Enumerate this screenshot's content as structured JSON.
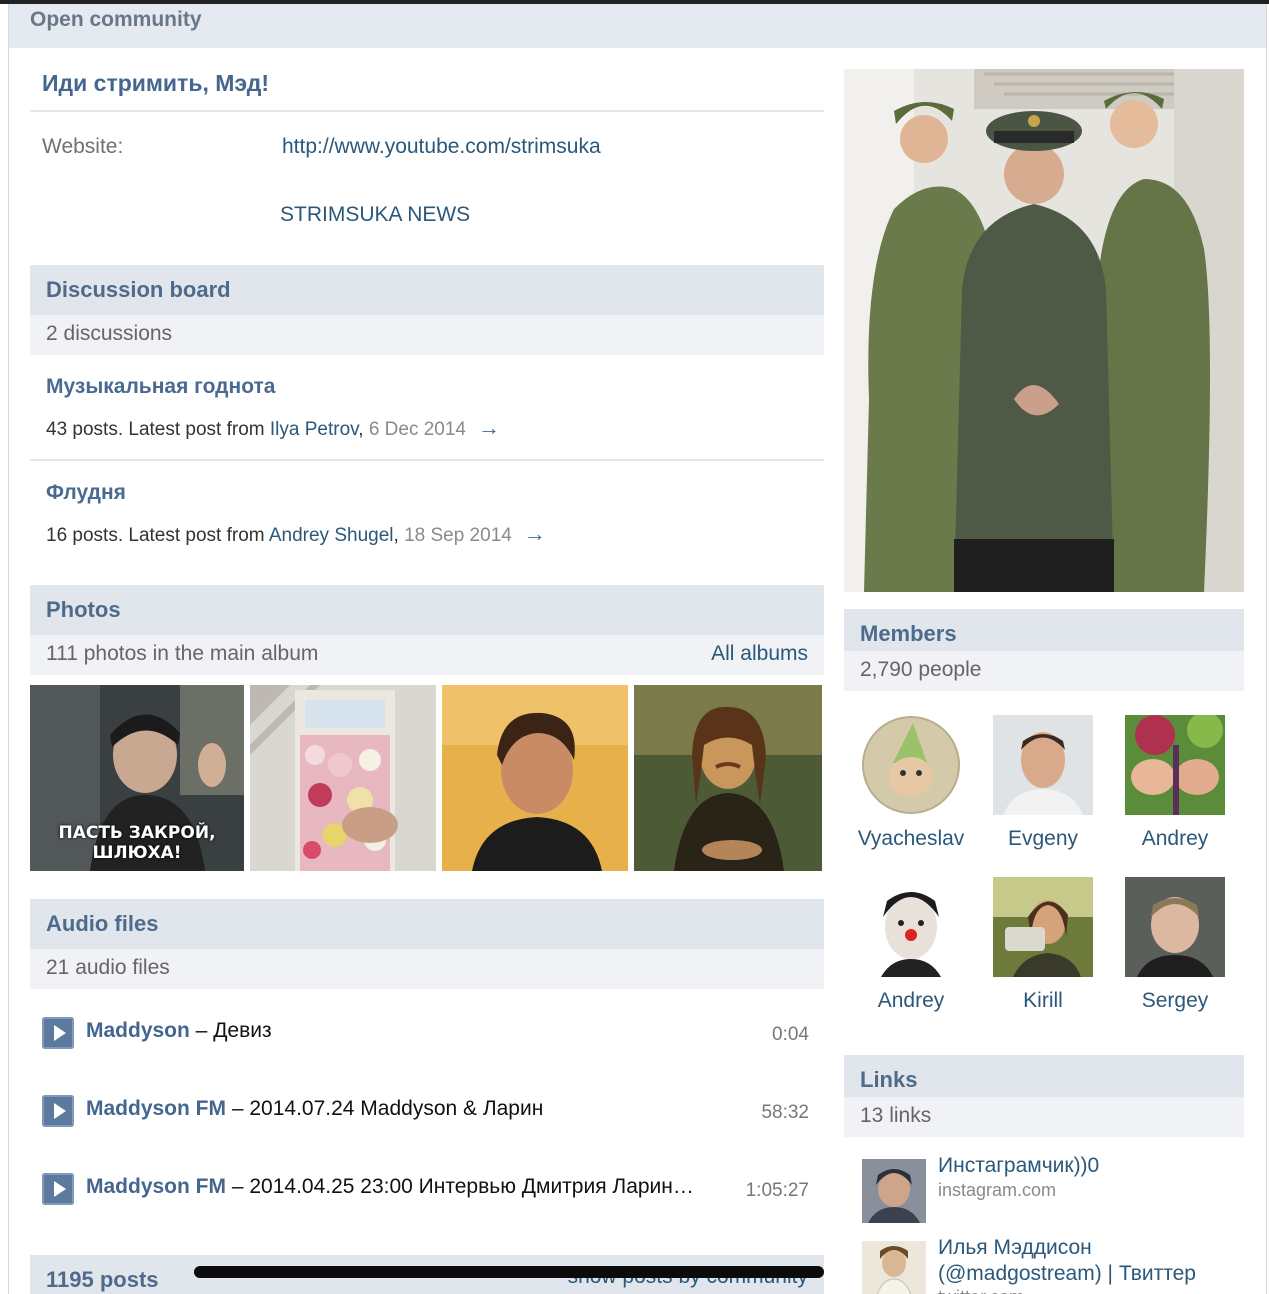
{
  "header": {
    "open_label": "Open community"
  },
  "community": {
    "title": "Иди стримить, Мэд!",
    "website_label": "Website:",
    "website_value": "http://www.youtube.com/strimsuka",
    "news_label": "STRIMSUKA NEWS"
  },
  "discussions": {
    "heading": "Discussion board",
    "count": "2 discussions",
    "items": [
      {
        "title": "Музыкальная годнота",
        "meta_prefix": "43 posts. Latest post from ",
        "author": "Ilya Petrov",
        "date": "6 Dec 2014",
        "arrow": "→"
      },
      {
        "title": "Флудня",
        "meta_prefix": "16 posts. Latest post from ",
        "author": "Andrey Shugel",
        "date": "18 Sep 2014",
        "arrow": "→"
      }
    ]
  },
  "photos": {
    "heading": "Photos",
    "count": "111 photos in the main album",
    "all_albums": "All albums",
    "caption_first": "ПАСТЬ ЗАКРОЙ, ШЛЮХА!"
  },
  "audio": {
    "heading": "Audio files",
    "count": "21 audio files",
    "tracks": [
      {
        "artist": "Maddyson",
        "title": " – Девиз",
        "duration": "0:04"
      },
      {
        "artist": "Maddyson FM",
        "title": " – 2014.07.24 Maddyson & Ларин",
        "duration": "58:32"
      },
      {
        "artist": "Maddyson FM",
        "title": " – 2014.04.25 23:00 Интервью Дмитрия Ларин…",
        "duration": "1:05:27"
      }
    ]
  },
  "posts": {
    "count": "1195 posts",
    "filter": "show posts by community"
  },
  "members": {
    "heading": "Members",
    "count": "2,790 people",
    "list": [
      "Vyacheslav",
      "Evgeny",
      "Andrey",
      "Andrey",
      "Kirill",
      "Sergey"
    ]
  },
  "links": {
    "heading": "Links",
    "count": "13 links",
    "items": [
      {
        "title": "Инстаграмчик))0",
        "domain": "instagram.com"
      },
      {
        "title": "Илья Мэддисон (@madgostream) | Твиттер",
        "domain": "twitter.com"
      }
    ]
  },
  "colors": {
    "accent": "#45668e",
    "link": "#2b587a",
    "section_header_bg": "#e1e6ec",
    "section_sub_bg": "#f0f2f5"
  }
}
